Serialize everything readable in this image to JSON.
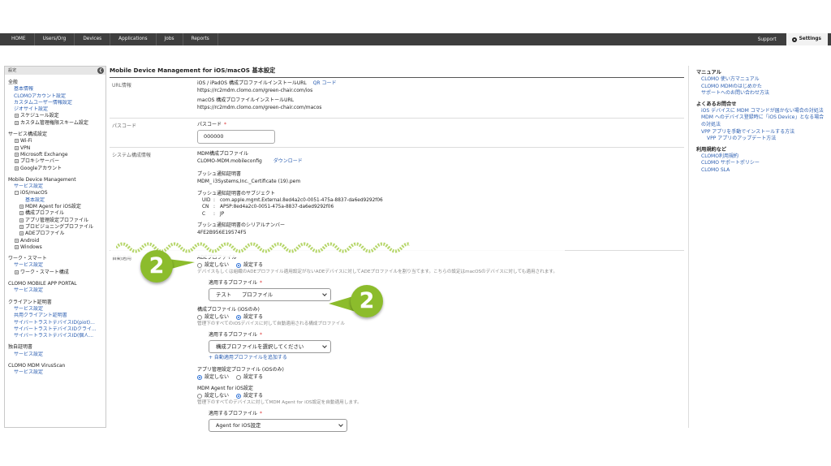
{
  "nav": {
    "items": [
      "HOME",
      "Users/Org",
      "Devices",
      "Applications",
      "Jobs",
      "Reports"
    ],
    "support": "Support",
    "settings": "Settings"
  },
  "sidebar": {
    "header": "設定",
    "collapse_icon": "chevron-left-icon",
    "general": {
      "title": "全般",
      "items": [
        "基本情報",
        "CLOMOアカウント設定",
        "カスタムユーザー情報設定",
        "ジオサイト設定"
      ],
      "nodes": [
        "スケジュール設定",
        "カスタム管理権限スキーム設定"
      ]
    },
    "service": {
      "title": "サービス構成設定",
      "nodes": [
        "Wi-Fi",
        "VPN",
        "Microsoft Exchange",
        "プロキシサーバー",
        "Googleアカウント"
      ]
    },
    "mdm": {
      "title": "Mobile Device Management",
      "service_link": "サービス設定",
      "ios_node": "iOS/macOS",
      "basic_link": "基本設定",
      "sub_nodes": [
        "MDM Agent for iOS設定",
        "構成プロファイル",
        "アプリ管理設定プロファイル",
        "プロビジョニングプロファイル",
        "ADEプロファイル"
      ],
      "nodes_after": [
        "Android",
        "Windows"
      ]
    },
    "workmart": {
      "title": "ワーク・スマート",
      "service_link": "サービス設定",
      "node": "ワーク・スマート構成"
    },
    "portal": {
      "title": "CLOMO MOBILE APP PORTAL",
      "service_link": "サービス設定"
    },
    "clientcert": {
      "title": "クライアント証明書",
      "items": [
        "サービス設定",
        "共用クライアント証明書",
        "サイバートラストデバイスID(piot)...",
        "サイバートラストデバイスIDクライ...",
        "サイバートラストデバイスID(個人..."
      ]
    },
    "owncert": {
      "title": "独自証明書",
      "service_link": "サービス設定"
    },
    "virusscan": {
      "title": "CLOMO MDM VirusScan",
      "service_link": "サービス設定"
    }
  },
  "main": {
    "title": "Mobile Device Management for iOS/macOS 基本設定",
    "url_section": {
      "label": "URL情報",
      "ios_label": "iOS / iPadOS 構成プロファイルインストールURL",
      "qr_link": "QR コード",
      "ios_url": "https://rc2mdm.clomo.com/green-chair.com/ios",
      "macos_label": "macOS 構成プロファイルインストールURL",
      "macos_url": "https://rc2mdm.clomo.com/green-chair.com/macos"
    },
    "passcode_section": {
      "label": "パスコード",
      "field_label": "パスコード",
      "required": "*",
      "value": "000000"
    },
    "system_section": {
      "label": "システム構成情報",
      "mdm_profile_label": "MDM構成プロファイル",
      "mdm_profile_file": "CLOMO-MDM.mobileconfig",
      "download_link": "ダウンロード",
      "push_cert_label": "プッシュ通知証明書",
      "push_cert_file": "MDM_ i3Systems,Inc._Certificate (19).pem",
      "subject_label": "プッシュ通知証明書のサブジェクト",
      "subject_rows": [
        {
          "k": "UID",
          "v": "com.apple.mgmt.External.8ed4a2c0-0051-475a-8837-da6ed9292f06"
        },
        {
          "k": "CN",
          "v": "APSP:8ed4a2c0-0051-475a-8837-da6ed9292f06"
        },
        {
          "k": "C",
          "v": "JP"
        }
      ],
      "serial_label": "プッシュ通知証明書のシリアルナンバー",
      "serial_value": "4FE2B956E19574F5"
    },
    "auto_section": {
      "label": "自動適用",
      "ade": {
        "title": "ADEプロファイル",
        "option_off": "設定しない",
        "option_on": "設定する",
        "selected": "設定する",
        "description": "デバイスもしくは組織のADEプロファイル適用設定がないADEデバイスに対してADEプロファイルを割り当てます。こちらの設定はmacOSのデバイスに対しても適用されます。",
        "apply_label": "適用するプロファイル",
        "apply_value": "テスト　　プロファイル"
      },
      "config": {
        "title": "構成プロファイル (iOSのみ)",
        "option_off": "設定しない",
        "option_on": "設定する",
        "selected": "設定する",
        "description": "管理下のすべてのiOSデバイスに対して自動適用される構成プロファイル",
        "apply_label": "適用するプロファイル",
        "apply_value": "構成プロファイルを選択してください",
        "add_link": "+ 自動適用プロファイルを追加する"
      },
      "appmgmt": {
        "title": "アプリ管理設定プロファイル (iOSのみ)",
        "option_off": "設定しない",
        "option_on": "設定する",
        "selected": "設定しない"
      },
      "agent": {
        "title": "MDM Agent for iOS設定",
        "option_off": "設定しない",
        "option_on": "設定する",
        "selected": "設定する",
        "description": "管理下のすべてのデバイスに対してMDM Agent for iOS設定を自動適用します。",
        "apply_label": "適用するプロファイル",
        "apply_value": "Agent for iOS設定"
      }
    }
  },
  "rightpanel": {
    "manual": {
      "title": "マニュアル",
      "links": [
        "CLOMO 使い方マニュアル",
        "CLOMO MDMのはじめかた",
        "サポートへのお問い合わせ方法"
      ]
    },
    "faq": {
      "title": "よくあるお問合せ",
      "links": [
        "iOS デバイスに MDM コマンドが届かない場合の対処法",
        "MDM へのデバイス登録時に「iOS Device」となる場合の対処法",
        "VPP アプリを手動でインストールする方法"
      ],
      "sub_link": "VPP アプリのアップデート方法"
    },
    "terms": {
      "title": "利用規約など",
      "links": [
        "CLOMO利用規約",
        "CLOMO サポートポリシー",
        "CLOMO SLA"
      ]
    }
  },
  "callouts": [
    "2",
    "2"
  ],
  "colors": {
    "nav_bg": "#3e3e3e",
    "link": "#2a5db0",
    "callout": "#8cbc2c",
    "required": "#d33333"
  }
}
